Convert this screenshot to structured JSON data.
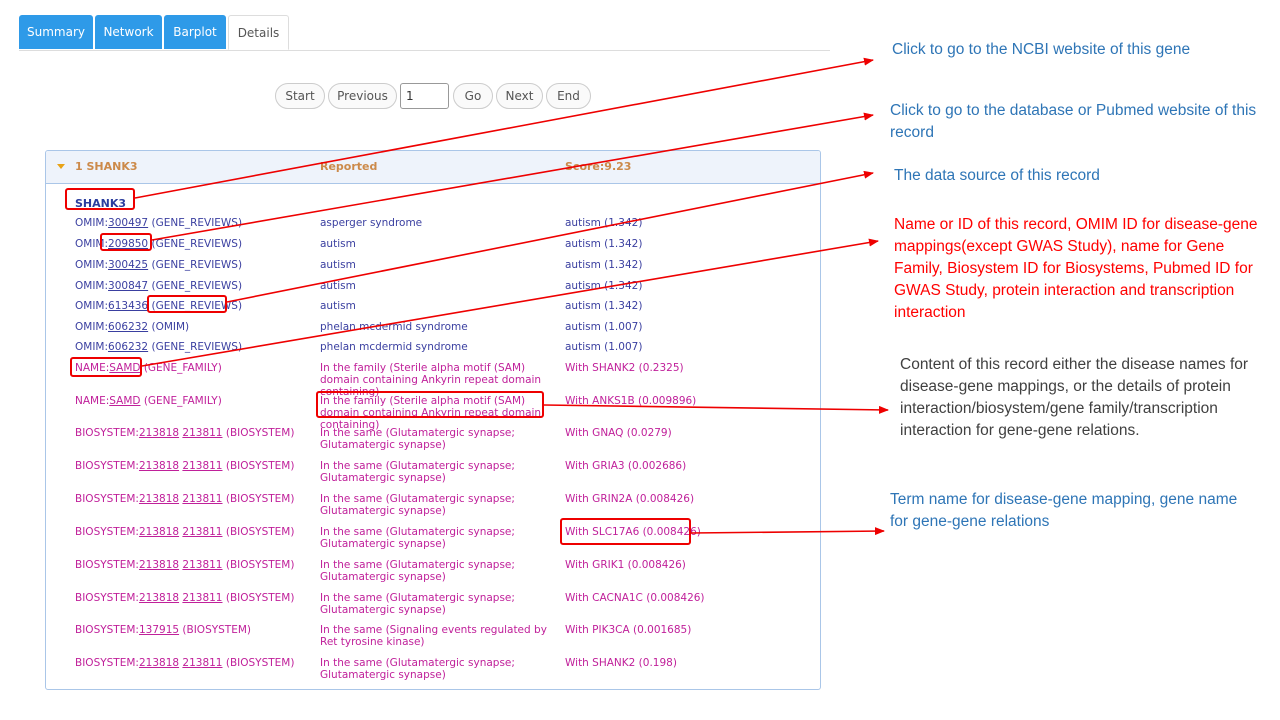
{
  "tabs": [
    {
      "label": "Summary",
      "active": true
    },
    {
      "label": "Network",
      "active": true
    },
    {
      "label": "Barplot",
      "active": true
    },
    {
      "label": "Details",
      "active": false
    }
  ],
  "pager": {
    "start": "Start",
    "previous": "Previous",
    "page_value": "1",
    "go": "Go",
    "next": "Next",
    "end": "End"
  },
  "panel": {
    "title": "1 SHANK3",
    "reported": "Reported",
    "score": "Score:9.23",
    "gene": "SHANK3",
    "rows": [
      {
        "color": "blue",
        "source": "OMIM",
        "ids": [
          "300497"
        ],
        "suffix": "(GENE_REVIEWS)",
        "content": "asperger syndrome",
        "term": "autism (1.342)"
      },
      {
        "color": "blue",
        "source": "OMIM",
        "ids": [
          "209850"
        ],
        "suffix": "(GENE_REVIEWS)",
        "content": "autism",
        "term": "autism (1.342)"
      },
      {
        "color": "blue",
        "source": "OMIM",
        "ids": [
          "300425"
        ],
        "suffix": "(GENE_REVIEWS)",
        "content": "autism",
        "term": "autism (1.342)"
      },
      {
        "color": "blue",
        "source": "OMIM",
        "ids": [
          "300847"
        ],
        "suffix": "(GENE_REVIEWS)",
        "content": "autism",
        "term": "autism (1.342)"
      },
      {
        "color": "blue",
        "source": "OMIM",
        "ids": [
          "613436"
        ],
        "suffix": "(GENE_REVIEWS)",
        "content": "autism",
        "term": "autism (1.342)"
      },
      {
        "color": "blue",
        "source": "OMIM",
        "ids": [
          "606232"
        ],
        "suffix": "(OMIM)",
        "content": "phelan mcdermid syndrome",
        "term": "autism (1.007)"
      },
      {
        "color": "blue",
        "source": "OMIM",
        "ids": [
          "606232"
        ],
        "suffix": "(GENE_REVIEWS)",
        "content": "phelan mcdermid syndrome",
        "term": "autism (1.007)"
      },
      {
        "color": "mag",
        "source": "NAME",
        "ids": [
          "SAMD"
        ],
        "suffix": "(GENE_FAMILY)",
        "content": "In the family (Sterile alpha motif (SAM) domain containing Ankyrin repeat domain containing)",
        "term": "With SHANK2 (0.2325)"
      },
      {
        "color": "mag",
        "source": "NAME",
        "ids": [
          "SAMD"
        ],
        "suffix": "(GENE_FAMILY)",
        "content": "In the family (Sterile alpha motif (SAM) domain containing Ankyrin repeat domain containing)",
        "term": "With ANKS1B (0.009896)"
      },
      {
        "color": "mag",
        "source": "BIOSYSTEM",
        "ids": [
          "213818",
          "213811"
        ],
        "suffix": "(BIOSYSTEM)",
        "content": "In the same (Glutamatergic synapse; Glutamatergic synapse)",
        "term": "With GNAQ (0.0279)"
      },
      {
        "color": "mag",
        "source": "BIOSYSTEM",
        "ids": [
          "213818",
          "213811"
        ],
        "suffix": "(BIOSYSTEM)",
        "content": "In the same (Glutamatergic synapse; Glutamatergic synapse)",
        "term": "With GRIA3 (0.002686)"
      },
      {
        "color": "mag",
        "source": "BIOSYSTEM",
        "ids": [
          "213818",
          "213811"
        ],
        "suffix": "(BIOSYSTEM)",
        "content": "In the same (Glutamatergic synapse; Glutamatergic synapse)",
        "term": "With GRIN2A (0.008426)"
      },
      {
        "color": "mag",
        "source": "BIOSYSTEM",
        "ids": [
          "213818",
          "213811"
        ],
        "suffix": "(BIOSYSTEM)",
        "content": "In the same (Glutamatergic synapse; Glutamatergic synapse)",
        "term": "With SLC17A6 (0.008426)"
      },
      {
        "color": "mag",
        "source": "BIOSYSTEM",
        "ids": [
          "213818",
          "213811"
        ],
        "suffix": "(BIOSYSTEM)",
        "content": "In the same (Glutamatergic synapse; Glutamatergic synapse)",
        "term": "With GRIK1 (0.008426)"
      },
      {
        "color": "mag",
        "source": "BIOSYSTEM",
        "ids": [
          "213818",
          "213811"
        ],
        "suffix": "(BIOSYSTEM)",
        "content": "In the same (Glutamatergic synapse; Glutamatergic synapse)",
        "term": "With CACNA1C (0.008426)"
      },
      {
        "color": "mag",
        "source": "BIOSYSTEM",
        "ids": [
          "137915"
        ],
        "suffix": "(BIOSYSTEM)",
        "content": "In the same (Signaling events regulated by Ret tyrosine kinase)",
        "term": "With PIK3CA (0.001685)"
      },
      {
        "color": "mag",
        "source": "BIOSYSTEM",
        "ids": [
          "213818",
          "213811"
        ],
        "suffix": "(BIOSYSTEM)",
        "content": "In the same (Glutamatergic synapse; Glutamatergic synapse)",
        "term": "With SHANK2 (0.198)"
      }
    ]
  },
  "annotations": {
    "ncbi": "Click to go to the NCBI website of this gene",
    "database": "Click to go to the database or Pubmed website of this record",
    "source": "The data source of this record",
    "name_id": "Name or ID of this record, OMIM ID for disease-gene mappings(except GWAS Study), name for Gene Family, Biosystem ID for Biosystems, Pubmed ID for GWAS Study, protein interaction and transcription interaction",
    "content": "Content of this record either the disease names for disease-gene mappings, or the details of protein interaction/biosystem/gene family/transcription interaction for gene-gene relations.",
    "term": "Term name for disease-gene mapping, gene name for gene-gene relations"
  },
  "colors": {
    "tab_active": "#2e9ae8",
    "row_blue": "#3a3fa0",
    "row_magenta": "#c0209a",
    "annotation_blue": "#2e75b6",
    "annotation_red": "#ff0000",
    "arrow_red": "#ee0000"
  }
}
